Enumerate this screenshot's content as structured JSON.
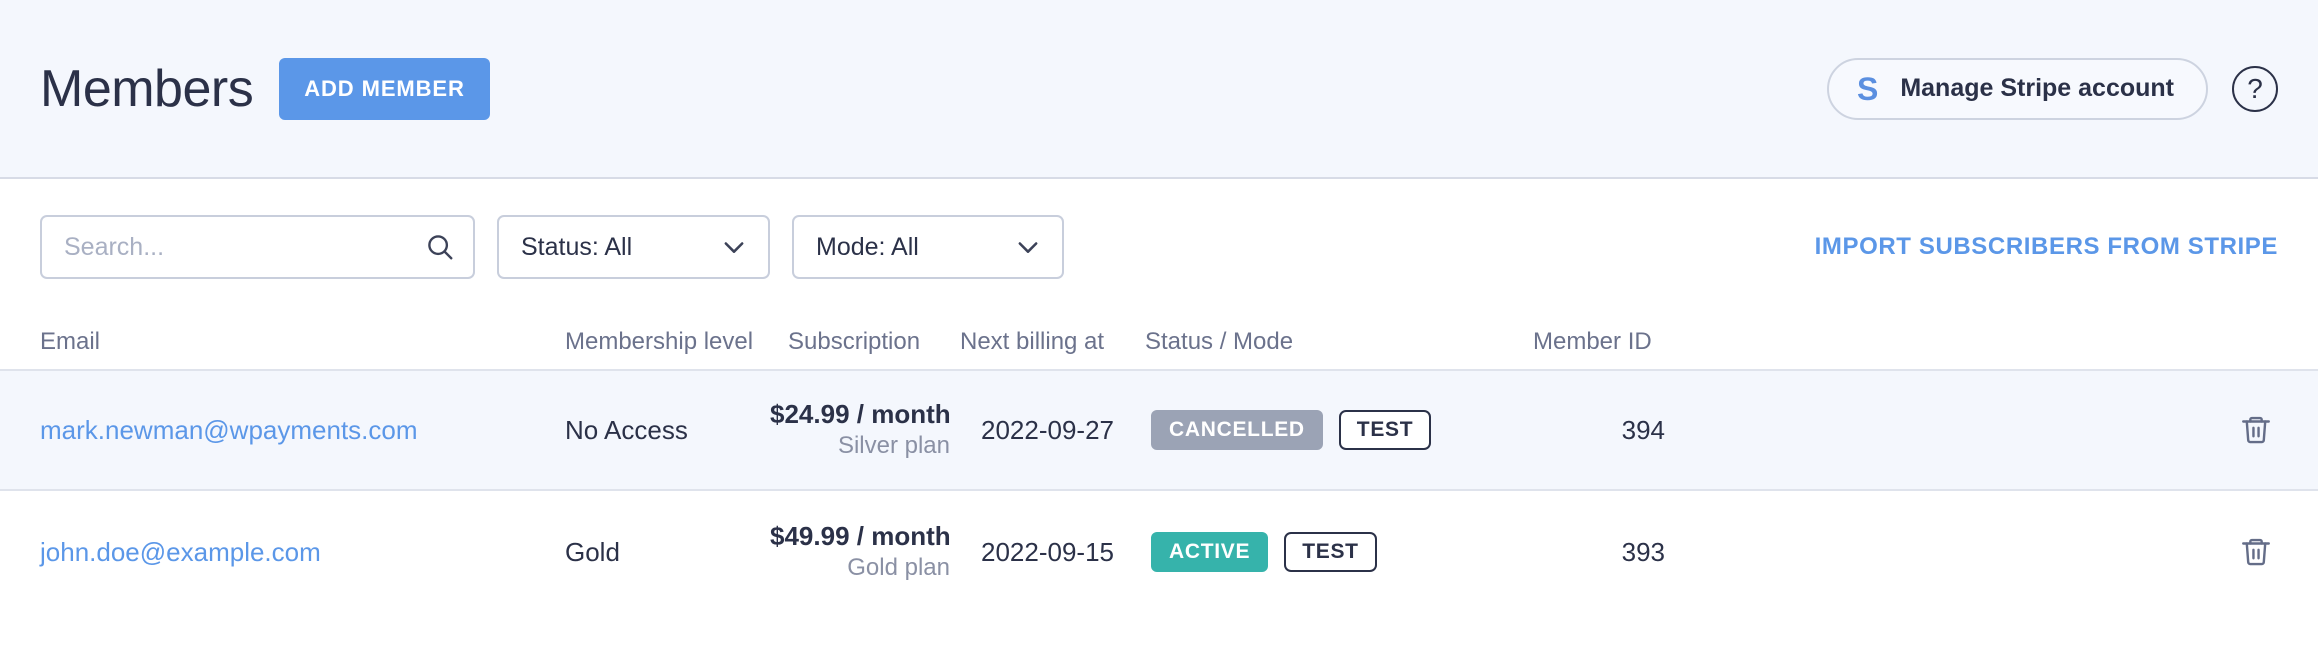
{
  "header": {
    "title": "Members",
    "add_member_label": "ADD MEMBER",
    "stripe_button": {
      "logo": "stripe-s-logo",
      "label": "Manage Stripe account"
    },
    "help_glyph": "?",
    "accent_blue": "#5b97e8",
    "background": "#f4f7fd"
  },
  "filters": {
    "search": {
      "placeholder": "Search...",
      "value": "",
      "icon": "search-icon"
    },
    "status_select": {
      "label": "Status: All",
      "icon": "chevron-down-icon"
    },
    "mode_select": {
      "label": "Mode: All",
      "icon": "chevron-down-icon"
    },
    "import_link": "IMPORT SUBSCRIBERS FROM STRIPE"
  },
  "table": {
    "columns": [
      "Email",
      "Membership level",
      "Subscription",
      "Next billing at",
      "Status / Mode",
      "Member ID"
    ],
    "rows": [
      {
        "email": "mark.newman@wpayments.com",
        "level": "No Access",
        "sub_amount": "$24.99 / month",
        "sub_plan": "Silver plan",
        "next_billing": "2022-09-27",
        "status": "CANCELLED",
        "status_color": "#9ba3b5",
        "mode": "TEST",
        "member_id": "394",
        "delete_icon": "trash-icon"
      },
      {
        "email": "john.doe@example.com",
        "level": "Gold",
        "sub_amount": "$49.99 / month",
        "sub_plan": "Gold plan",
        "next_billing": "2022-09-15",
        "status": "ACTIVE",
        "status_color": "#36b3ab",
        "mode": "TEST",
        "member_id": "393",
        "delete_icon": "trash-icon"
      }
    ]
  }
}
